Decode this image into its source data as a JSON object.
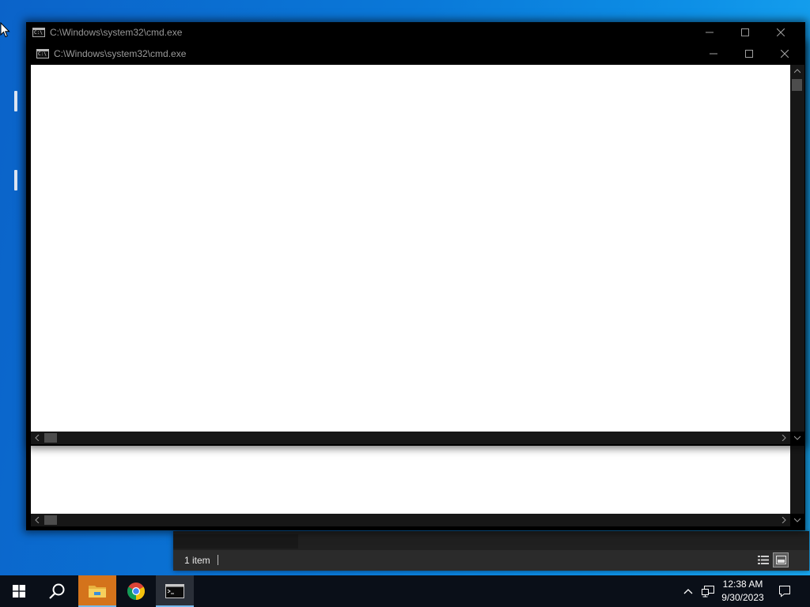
{
  "cmd_back": {
    "title": "C:\\Windows\\system32\\cmd.exe"
  },
  "cmd_front": {
    "title": "C:\\Windows\\system32\\cmd.exe"
  },
  "explorer": {
    "status_count": "1 item"
  },
  "taskbar": {
    "items": [
      "start-icon",
      "search-icon",
      "file-explorer-icon",
      "chrome-icon",
      "command-prompt-icon"
    ],
    "clock_time": "12:38 AM",
    "clock_date": "9/30/2023"
  },
  "colors": {
    "desktop_accent": "#0a78d8",
    "titlebar": "#000000",
    "explorer_taskbar_highlight": "#d4731b",
    "taskbar": "#0a0f18"
  }
}
